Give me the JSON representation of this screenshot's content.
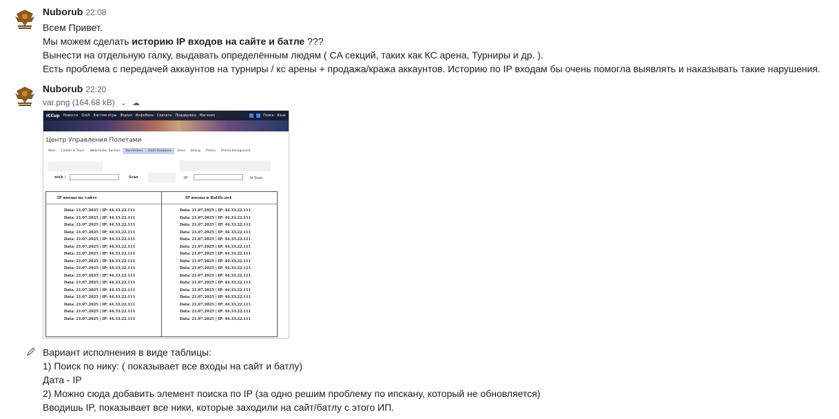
{
  "messages": [
    {
      "author": "Nuborub",
      "time": "22:08",
      "lines": [
        "Всем Привет.",
        "Мы можем сделать ",
        "Вынести на отдельную галку, выдавать определённым людям ( CA секций, таких как КС арена, Турниры и др. ).",
        "Есть проблема с передачей аккаунтов на турниры / кс арены + продажа/кража аккаунтов. Историю по IP входам бы очень помогла выявлять и наказывать такие нарушения."
      ],
      "bold_phrase": "историю IP входов на сайте и батле",
      "bold_suffix": " ???"
    },
    {
      "author": "Nuborub",
      "time": "22:20",
      "file": {
        "name": "var.png",
        "size": "(164.68 kB)"
      },
      "lines": [
        "Вариант исполнения в виде таблицы:",
        "1) Поиск по нику: ( показывает все входы на сайт и батлу)",
        "Дата - IP",
        "2) Можно сюда добавить элемент поиска по IP (за одно решим проблему по ипскану, который не обновляется)",
        "Вводишь IP, показывает все ники, которые заходили на сайт/батлу с этого ИП."
      ]
    }
  ],
  "attachment": {
    "nav": {
      "logo": "ICCup",
      "items": [
        "Новости",
        "DotA",
        "Кастом игры",
        "Форум",
        "Инфобаза",
        "Скачать",
        "Поддержка",
        "Магазин"
      ],
      "right": [
        "Поиск",
        "Язык"
      ]
    },
    "page_title": "Центр Управления Полетами",
    "tabs": [
      "Main",
      "Ladder & Tours",
      "Webmaster Section",
      "Ban/Unban",
      "DotA Database",
      "Store",
      "Billing",
      "Promo",
      "Promo background"
    ],
    "nick_label": "nick :",
    "scan_label": "Scan",
    "ip_label": "IP:",
    "ip_scan_label": "Ip Scan",
    "left_header": "IP входы на сайте",
    "right_header": "IP входы в Battle.net",
    "row_text": "Data: 21.07.2025    |  IP: 44.33.22.111",
    "left_rows": 16,
    "right_rows": 16
  },
  "icons": {
    "avatar": "cyber-cup-eagle-logo",
    "file_menu": "chevron-down-icon",
    "file_link": "cloud-icon",
    "edited": "pencil-icon"
  }
}
